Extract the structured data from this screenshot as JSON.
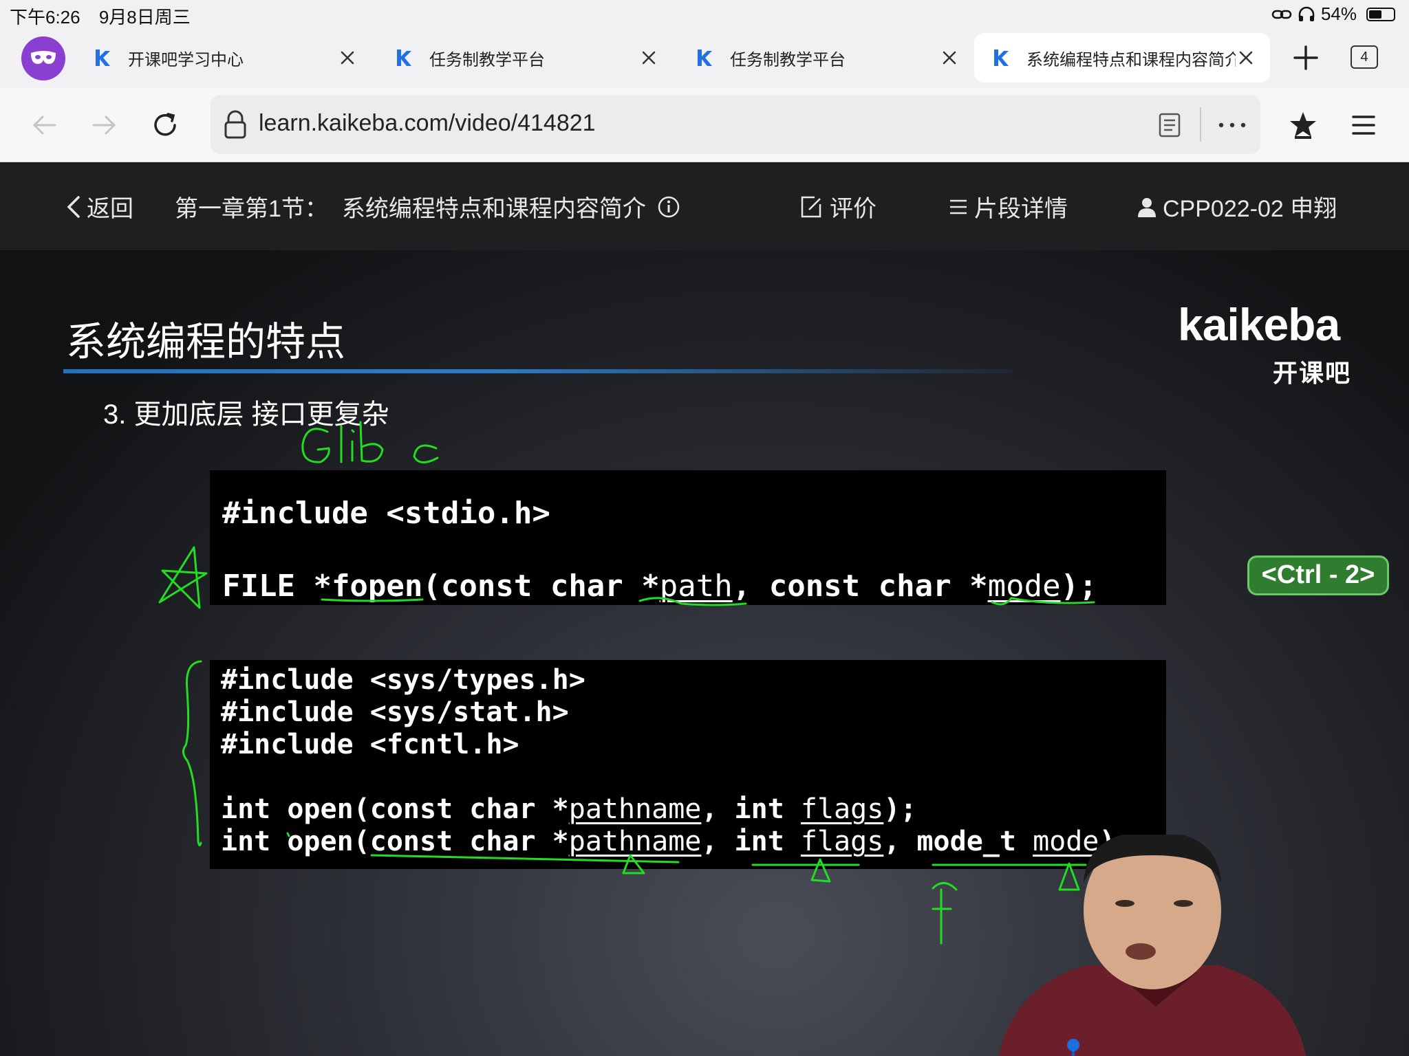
{
  "status_bar": {
    "time": "下午6:26",
    "date": "9月8日周三",
    "battery": "54%",
    "battery_level": 0.54
  },
  "tabs": [
    {
      "title": "开课吧学习中心",
      "active": false
    },
    {
      "title": "任务制教学平台",
      "active": false
    },
    {
      "title": "任务制教学平台",
      "active": false
    },
    {
      "title": "系统编程特点和课程内容简介",
      "active": true
    }
  ],
  "tab_count": "4",
  "url_bar": {
    "url": "learn.kaikeba.com/video/414821"
  },
  "page_header": {
    "back_label": "返回",
    "lesson_prefix": "第一章第1节：",
    "lesson_title": "系统编程特点和课程内容简介",
    "review_label": "评价",
    "segments_label": "片段详情",
    "user_label": "CPP022-02 申翔"
  },
  "slide": {
    "title": "系统编程的特点",
    "logo_text": "kaikeba",
    "logo_cn": "开课吧",
    "point": "3. 更加底层  接口更复杂",
    "code1": {
      "include": "#include <stdio.h>",
      "prototype_parts": [
        "FILE *fopen(const char *",
        "path",
        ", const char *",
        "mode",
        ");"
      ]
    },
    "code2": {
      "includes": [
        "#include <sys/types.h>",
        "#include <sys/stat.h>",
        "#include <fcntl.h>"
      ],
      "line1_parts": [
        "int open(const char *",
        "pathname",
        ", int ",
        "flags",
        ");"
      ],
      "line2_parts": [
        "int open(const char *",
        "pathname",
        ", int ",
        "flags",
        ", mode_t ",
        "mode",
        ");"
      ]
    },
    "handwriting": "Glibc",
    "ctrl_badge": "<Ctrl - 2>"
  },
  "colors": {
    "tab_bar_bg": "#f1f1f3",
    "header_bg": "#1f1f21",
    "annotation_green": "#22dd22",
    "badge_green": "#2f7d2f",
    "title_rule_blue": "#1e73c5",
    "profile_purple": "#8b3fd0"
  }
}
